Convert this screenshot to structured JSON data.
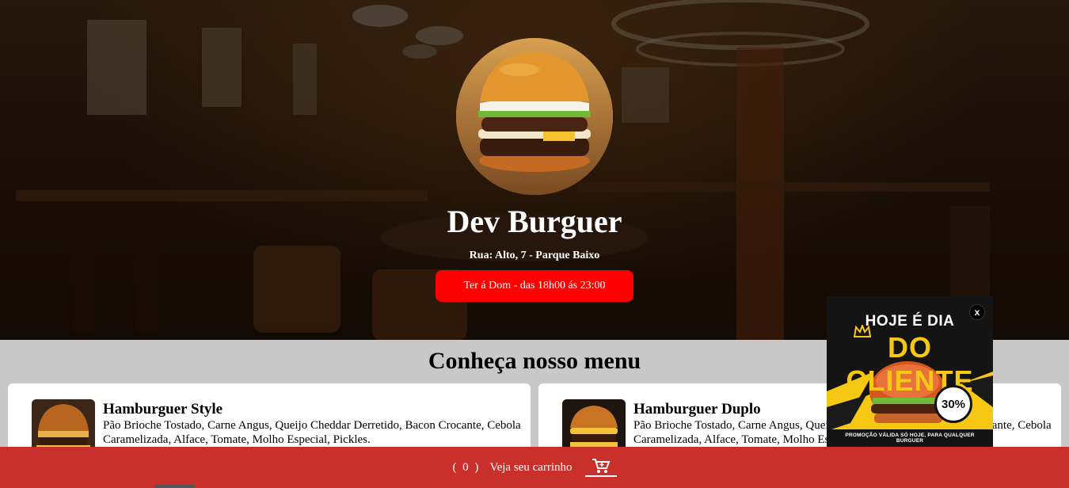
{
  "header": {
    "brand_name": "Dev Burguer",
    "address": "Rua: Alto, 7 - Parque Baixo",
    "hours": "Ter á Dom - das 18h00 ás 23:00"
  },
  "menu": {
    "heading": "Conheça nosso menu",
    "items": [
      {
        "name": "Hamburguer Style",
        "description": "Pão Brioche Tostado, Carne Angus, Queijo Cheddar Derretido, Bacon Crocante, Cebola Caramelizada, Alface, Tomate, Molho Especial, Pickles."
      },
      {
        "name": "Hamburguer Duplo",
        "description": "Pão Brioche Tostado, Carne Angus, Queijo Cheddar Derretido, Bacon Crocante, Cebola Caramelizada, Alface, Tomate, Molho Especial, Pickles."
      }
    ]
  },
  "promo": {
    "line1": "HOJE É DIA",
    "line2": "DO CLIENTE",
    "discount": "30%",
    "footer": "PROMOÇÃO VÁLIDA SÓ HOJE, PARA QUALQUER BURGUER",
    "close_label": "x"
  },
  "cart": {
    "count_text": "( 0 )",
    "label": "Veja seu carrinho",
    "icon": "cart-icon"
  },
  "colors": {
    "accent_red": "#fe0000",
    "cart_bar": "#c9302c",
    "promo_yellow": "#f6c814"
  }
}
